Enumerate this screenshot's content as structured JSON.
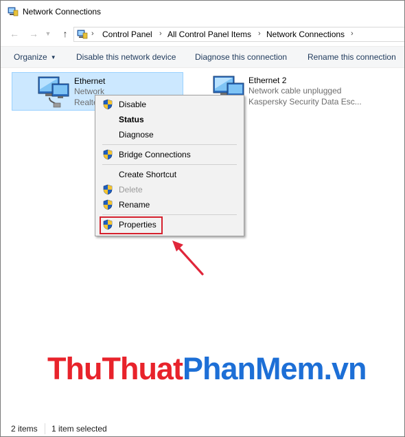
{
  "window": {
    "title": "Network Connections"
  },
  "address": {
    "breadcrumbs": [
      "Control Panel",
      "All Control Panel Items",
      "Network Connections"
    ]
  },
  "commands": {
    "organize": "Organize",
    "disable": "Disable this network device",
    "diagnose": "Diagnose this connection",
    "rename": "Rename this connection"
  },
  "items": [
    {
      "name": "Ethernet",
      "line1": "Network",
      "line2": "Realte"
    },
    {
      "name": "Ethernet 2",
      "line1": "Network cable unplugged",
      "line2": "Kaspersky Security Data Esc..."
    }
  ],
  "context_menu": {
    "disable": "Disable",
    "status": "Status",
    "diagnose": "Diagnose",
    "bridge": "Bridge Connections",
    "shortcut": "Create Shortcut",
    "delete": "Delete",
    "rename": "Rename",
    "properties": "Properties"
  },
  "watermark": {
    "part1": "ThuThuat",
    "part2": "PhanMem.vn"
  },
  "status": {
    "count": "2 items",
    "selected": "1 item selected"
  },
  "colors": {
    "selection": "#cce8ff",
    "highlight": "#d5202d",
    "watermark_red": "#e8232b",
    "watermark_blue": "#1d6fd6"
  }
}
